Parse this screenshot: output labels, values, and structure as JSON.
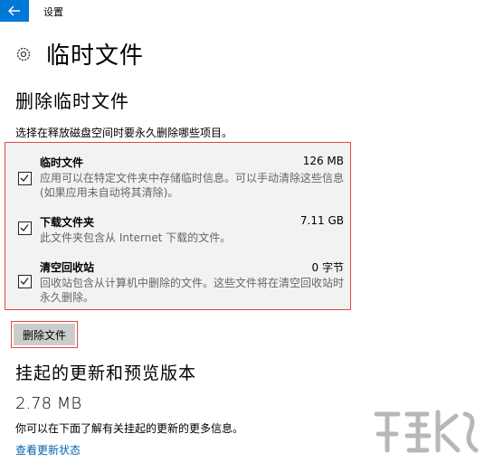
{
  "app": {
    "title": "设置"
  },
  "page": {
    "title": "临时文件"
  },
  "delete_section": {
    "title": "删除临时文件",
    "intro": "选择在释放磁盘空间时要永久删除哪些项目。",
    "items": [
      {
        "name": "临时文件",
        "size": "126 MB",
        "checked": true,
        "description": "应用可以在特定文件夹中存储临时信息。可以手动清除这些信息(如果应用未自动将其清除)。"
      },
      {
        "name": "下载文件夹",
        "size": "7.11 GB",
        "checked": true,
        "description": "此文件夹包含从 Internet 下载的文件。"
      },
      {
        "name": "清空回收站",
        "size": "0 字节",
        "checked": true,
        "description": "回收站包含从计算机中删除的文件。这些文件将在清空回收站时永久删除。"
      }
    ],
    "button_label": "删除文件"
  },
  "pending_updates": {
    "title": "挂起的更新和预览版本",
    "size": "2.78 MB",
    "info": "你可以在下面了解有关挂起的更新的更多信息。",
    "link": "查看更新状态"
  },
  "colors": {
    "accent": "#0078d7",
    "highlight_border": "#e0484a",
    "link": "#0063b1"
  },
  "icons": {
    "back": "back-arrow-icon",
    "page": "gear-icon",
    "checkbox": "checkmark-icon"
  }
}
